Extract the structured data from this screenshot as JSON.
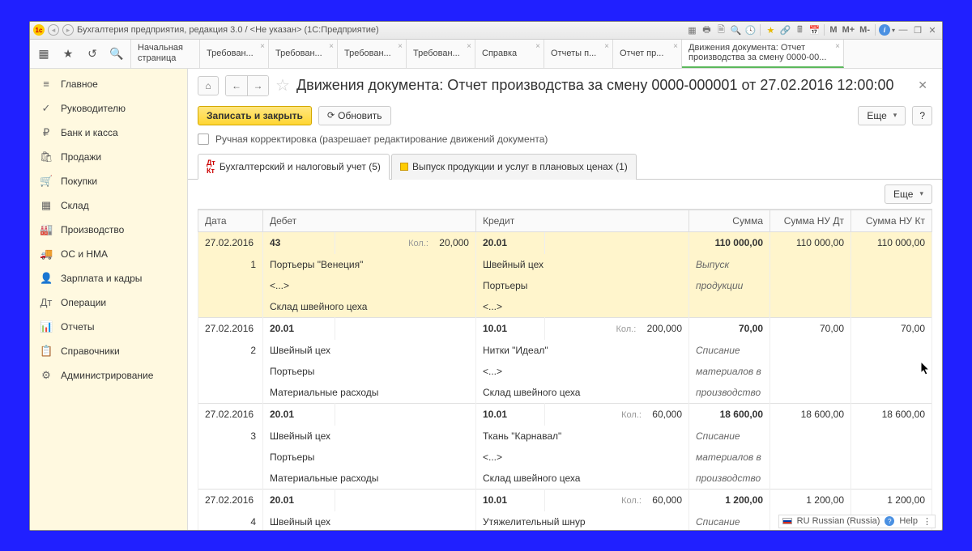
{
  "title_bar": "Бухгалтерия предприятия, редакция 3.0 / <Не указан>   (1С:Предприятие)",
  "title_m_buttons": [
    "M",
    "M+",
    "M-"
  ],
  "top_tabs": [
    {
      "label1": "Начальная",
      "label2": "страница",
      "closable": false
    },
    {
      "label1": "Требован...",
      "label2": "",
      "closable": true
    },
    {
      "label1": "Требован...",
      "label2": "",
      "closable": true
    },
    {
      "label1": "Требован...",
      "label2": "",
      "closable": true
    },
    {
      "label1": "Требован...",
      "label2": "",
      "closable": true
    },
    {
      "label1": "Справка",
      "label2": "",
      "closable": true
    },
    {
      "label1": "Отчеты п...",
      "label2": "",
      "closable": true
    },
    {
      "label1": "Отчет пр...",
      "label2": "",
      "closable": true
    },
    {
      "label1": "Движения документа: Отчет",
      "label2": "производства за смену 0000-00...",
      "closable": true,
      "active": true
    }
  ],
  "sidebar": [
    {
      "icon": "≡",
      "label": "Главное"
    },
    {
      "icon": "✓",
      "label": "Руководителю"
    },
    {
      "icon": "₽",
      "label": "Банк и касса"
    },
    {
      "icon": "🛍",
      "label": "Продажи"
    },
    {
      "icon": "🛒",
      "label": "Покупки"
    },
    {
      "icon": "▦",
      "label": "Склад"
    },
    {
      "icon": "🏭",
      "label": "Производство"
    },
    {
      "icon": "🚚",
      "label": "ОС и НМА"
    },
    {
      "icon": "👤",
      "label": "Зарплата и кадры"
    },
    {
      "icon": "Дт",
      "label": "Операции"
    },
    {
      "icon": "📊",
      "label": "Отчеты"
    },
    {
      "icon": "📋",
      "label": "Справочники"
    },
    {
      "icon": "⚙",
      "label": "Администрирование"
    }
  ],
  "page_title": "Движения документа: Отчет производства за смену 0000-000001 от 27.02.2016 12:00:00",
  "buttons": {
    "save_close": "Записать и закрыть",
    "refresh": "Обновить",
    "more": "Еще",
    "help": "?"
  },
  "checkbox_label": "Ручная корректировка (разрешает редактирование движений документа)",
  "inner_tabs": [
    {
      "label": "Бухгалтерский и налоговый учет (5)"
    },
    {
      "label": "Выпуск продукции и услуг в плановых ценах (1)"
    }
  ],
  "grid_headers": {
    "date": "Дата",
    "debit": "Дебет",
    "credit": "Кредит",
    "sum": "Сумма",
    "nu_dt": "Сумма НУ Дт",
    "nu_kt": "Сумма НУ Кт"
  },
  "kol_label": "Кол.:",
  "ellipsis": "<...>",
  "rows": [
    {
      "date": "27.02.2016",
      "n": "1",
      "selected": true,
      "dt_acc": "43",
      "dt_qty": "20,000",
      "dt_l1": "Портьеры \"Венеция\"",
      "dt_l2": "<...>",
      "dt_l3": "Склад швейного цеха",
      "kt_acc": "20.01",
      "kt_qty": "",
      "kt_l1": "Швейный цех",
      "kt_l2": "Портьеры",
      "kt_l3": "<...>",
      "sum": "110 000,00",
      "nu_dt": "110 000,00",
      "nu_kt": "110 000,00",
      "desc1": "Выпуск",
      "desc2": "продукции"
    },
    {
      "date": "27.02.2016",
      "n": "2",
      "dt_acc": "20.01",
      "dt_qty": "",
      "dt_l1": "Швейный цех",
      "dt_l2": "Портьеры",
      "dt_l3": "Материальные расходы",
      "kt_acc": "10.01",
      "kt_qty": "200,000",
      "kt_l1": "Нитки \"Идеал\"",
      "kt_l2": "<...>",
      "kt_l3": "Склад швейного цеха",
      "sum": "70,00",
      "nu_dt": "70,00",
      "nu_kt": "70,00",
      "desc1": "Списание",
      "desc2": "материалов в",
      "desc3": "производство"
    },
    {
      "date": "27.02.2016",
      "n": "3",
      "dt_acc": "20.01",
      "dt_qty": "",
      "dt_l1": "Швейный цех",
      "dt_l2": "Портьеры",
      "dt_l3": "Материальные расходы",
      "kt_acc": "10.01",
      "kt_qty": "60,000",
      "kt_l1": "Ткань \"Карнавал\"",
      "kt_l2": "<...>",
      "kt_l3": "Склад швейного цеха",
      "sum": "18 600,00",
      "nu_dt": "18 600,00",
      "nu_kt": "18 600,00",
      "desc1": "Списание",
      "desc2": "материалов в",
      "desc3": "производство"
    },
    {
      "date": "27.02.2016",
      "n": "4",
      "dt_acc": "20.01",
      "dt_qty": "",
      "dt_l1": "Швейный цех",
      "kt_acc": "10.01",
      "kt_qty": "60,000",
      "kt_l1": "Утяжелительный шнур",
      "sum": "1 200,00",
      "nu_dt": "1 200,00",
      "nu_kt": "1 200,00",
      "desc1": "Списание"
    }
  ],
  "status": {
    "lang": "RU Russian (Russia)",
    "help": "Help"
  }
}
